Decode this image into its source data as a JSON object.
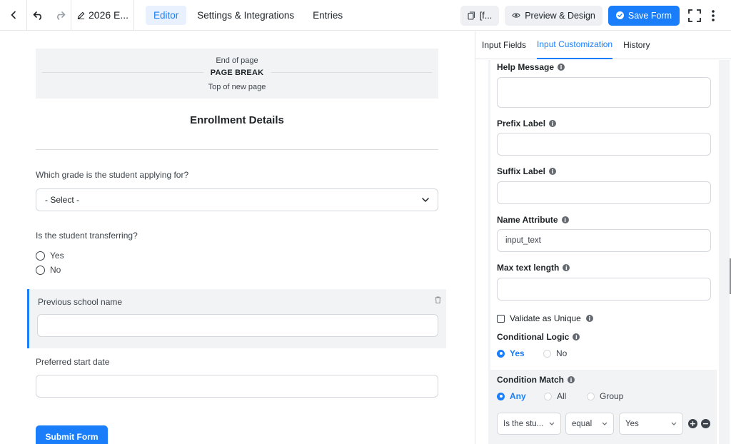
{
  "toolbar": {
    "form_title": "2026 E...",
    "tabs": [
      {
        "label": "Editor",
        "active": true
      },
      {
        "label": "Settings & Integrations",
        "active": false
      },
      {
        "label": "Entries",
        "active": false
      }
    ],
    "shortcode_label": "[f...",
    "preview_label": "Preview & Design",
    "save_label": "Save Form"
  },
  "canvas": {
    "page_break": {
      "end_label": "End of page",
      "label": "PAGE BREAK",
      "top_label": "Top of new page"
    },
    "section_title": "Enrollment Details",
    "grade_question": "Which grade is the student applying for?",
    "grade_select_value": "- Select -",
    "transfer_question": "Is the student transferring?",
    "transfer_options": [
      "Yes",
      "No"
    ],
    "previous_school_label": "Previous school name",
    "start_date_label": "Preferred start date",
    "submit_label": "Submit Form"
  },
  "panel": {
    "tabs": [
      {
        "label": "Input Fields",
        "active": false
      },
      {
        "label": "Input Customization",
        "active": true
      },
      {
        "label": "History",
        "active": false
      }
    ],
    "help_message_label": "Help Message",
    "prefix_label": "Prefix Label",
    "suffix_label": "Suffix Label",
    "name_attribute_label": "Name Attribute",
    "name_attribute_value": "input_text",
    "max_length_label": "Max text length",
    "validate_unique_label": "Validate as Unique",
    "conditional_logic_label": "Conditional Logic",
    "conditional_logic_options": [
      {
        "label": "Yes",
        "selected": true
      },
      {
        "label": "No",
        "selected": false
      }
    ],
    "condition_match_label": "Condition Match",
    "condition_match_options": [
      {
        "label": "Any",
        "selected": true
      },
      {
        "label": "All",
        "selected": false
      },
      {
        "label": "Group",
        "selected": false
      }
    ],
    "condition_row": {
      "field": "Is the stu...",
      "operator": "equal",
      "value": "Yes"
    }
  },
  "colors": {
    "accent": "#1a7efb",
    "panel_bg": "#f2f3f5"
  }
}
